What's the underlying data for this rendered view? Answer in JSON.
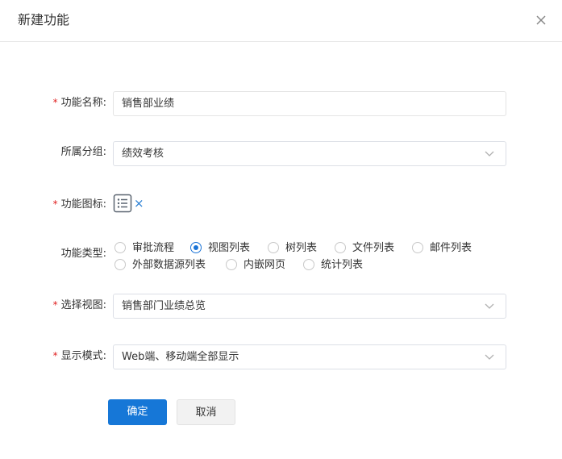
{
  "dialog": {
    "title": "新建功能",
    "close_icon": "close-icon"
  },
  "form": {
    "name": {
      "label": "功能名称:",
      "required": true,
      "value": "销售部业绩"
    },
    "group": {
      "label": "所属分组:",
      "required": false,
      "value": "绩效考核"
    },
    "icon": {
      "label": "功能图标:",
      "required": true,
      "icon": "list-icon",
      "remove_symbol": "×"
    },
    "type": {
      "label": "功能类型:",
      "required": false,
      "options": [
        "审批流程",
        "视图列表",
        "树列表",
        "文件列表",
        "邮件列表",
        "外部数据源列表",
        "内嵌网页",
        "统计列表"
      ],
      "selected": "视图列表"
    },
    "view": {
      "label": "选择视图:",
      "required": true,
      "value": "销售部门业绩总览"
    },
    "mode": {
      "label": "显示模式:",
      "required": true,
      "value": "Web端、移动端全部显示"
    }
  },
  "buttons": {
    "confirm": "确定",
    "cancel": "取消"
  },
  "colors": {
    "accent": "#1677d7",
    "required": "#e02020"
  }
}
